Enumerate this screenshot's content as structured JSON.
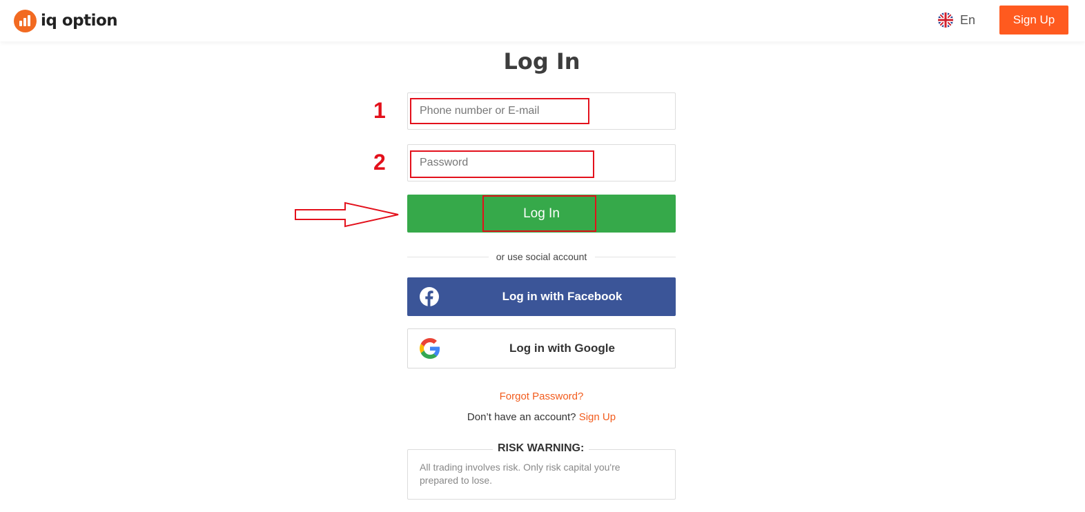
{
  "header": {
    "logo_text": "iq option",
    "language": "En",
    "signup_label": "Sign Up"
  },
  "login": {
    "title": "Log In",
    "email_placeholder": "Phone number or E-mail",
    "password_placeholder": "Password",
    "submit_label": "Log In",
    "divider_text": "or use social account",
    "facebook_label": "Log in with Facebook",
    "google_label": "Log in with Google",
    "forgot_label": "Forgot Password?",
    "no_account_text": "Don’t have an account?",
    "signup_link": "Sign Up"
  },
  "risk": {
    "title": "RISK WARNING:",
    "text": "All trading involves risk. Only risk capital you're prepared to lose."
  },
  "annotations": {
    "step1": "1",
    "step2": "2"
  },
  "colors": {
    "brand_orange": "#ff5a1f",
    "login_green": "#36a94a",
    "facebook_blue": "#3b5598",
    "annotation_red": "#e3101b"
  },
  "icons": [
    "uk-flag-icon",
    "facebook-icon",
    "google-icon",
    "arrow-right-icon"
  ]
}
